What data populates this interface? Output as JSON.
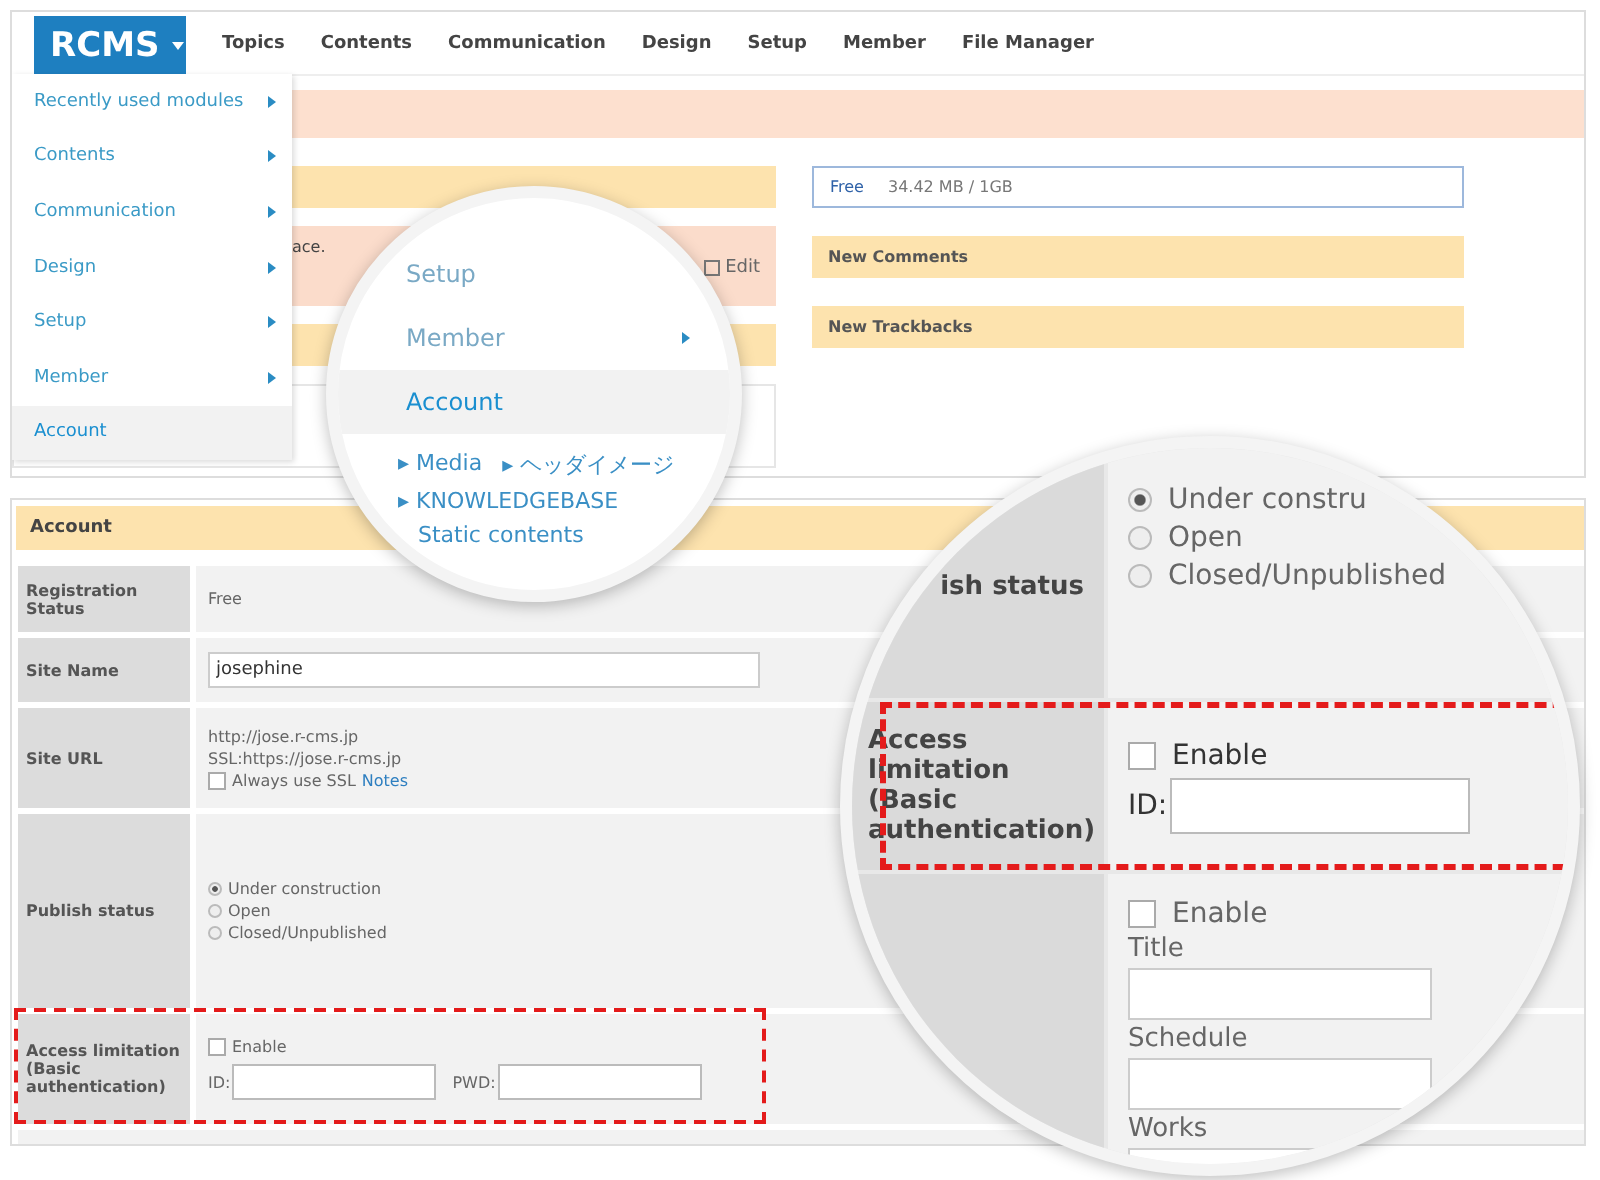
{
  "header": {
    "logo": "RCMS",
    "nav": [
      "Topics",
      "Contents",
      "Communication",
      "Design",
      "Setup",
      "Member",
      "File Manager"
    ]
  },
  "menu": {
    "items": [
      {
        "label": "Recently used modules",
        "submenu": true,
        "selected": false
      },
      {
        "label": "Contents",
        "submenu": true,
        "selected": false
      },
      {
        "label": "Communication",
        "submenu": true,
        "selected": false
      },
      {
        "label": "Design",
        "submenu": true,
        "selected": false
      },
      {
        "label": "Setup",
        "submenu": true,
        "selected": false
      },
      {
        "label": "Member",
        "submenu": true,
        "selected": false
      },
      {
        "label": "Account",
        "submenu": false,
        "selected": true
      }
    ]
  },
  "dashboard": {
    "notice_fragment": "ace.",
    "edit": "Edit",
    "storage": {
      "plan": "Free",
      "usage": "34.42 MB / 1GB"
    },
    "panels": [
      "New Comments",
      "New Trackbacks"
    ]
  },
  "account": {
    "title": "Account",
    "rows": [
      {
        "kind": "text",
        "label": "Registration Status",
        "value": "Free"
      },
      {
        "kind": "input",
        "label": "Site Name",
        "value": "josephine"
      },
      {
        "kind": "url",
        "label": "Site URL",
        "lines": [
          "http://jose.r-cms.jp",
          "SSL:https://jose.r-cms.jp"
        ],
        "ssl": {
          "label": "Always use SSL",
          "checked": false,
          "link": "Notes"
        }
      },
      {
        "kind": "radio",
        "label": "Publish status",
        "options": [
          {
            "label": "Under construction",
            "selected": true
          },
          {
            "label": "Open",
            "selected": false
          },
          {
            "label": "Closed/Unpublished",
            "selected": false
          }
        ]
      },
      {
        "kind": "auth",
        "label": "Access limitation (Basic authentication)",
        "highlighted": true,
        "enable": {
          "label": "Enable",
          "checked": false
        },
        "id_label": "ID:",
        "pwd_label": "PWD:"
      }
    ]
  },
  "magnifier_menu": {
    "items": [
      {
        "label": "Setup",
        "submenu": false,
        "selected": false
      },
      {
        "label": "Member",
        "submenu": true,
        "selected": false
      },
      {
        "label": "Account",
        "submenu": false,
        "selected": true
      }
    ],
    "links": [
      "▸ Media",
      "▸ ヘッダイメージ",
      "▸ KNOWLEDGEBASE",
      "Static contents"
    ]
  },
  "magnifier_form": {
    "publish_label": "ish status",
    "options": [
      {
        "label": "Under constru",
        "selected": true
      },
      {
        "label": "Open",
        "selected": false
      },
      {
        "label": "Closed/Unpublished",
        "selected": false
      }
    ],
    "auth": {
      "label": "Access limitation (Basic authentication)",
      "highlighted": true,
      "enable": {
        "label": "Enable",
        "checked": false
      },
      "id_label": "ID:"
    },
    "next": {
      "enable": {
        "label": "Enable",
        "checked": false
      },
      "fields": [
        "Title",
        "Schedule",
        "Works"
      ]
    }
  }
}
